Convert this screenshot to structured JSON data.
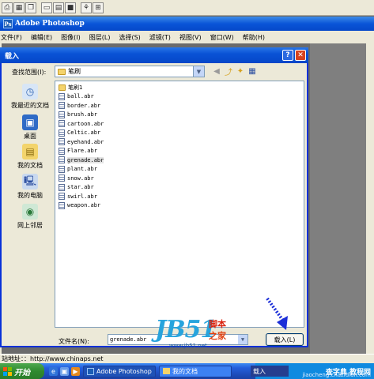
{
  "app": {
    "title": "Adobe Photoshop",
    "menu": [
      "文件(F)",
      "编辑(E)",
      "图像(I)",
      "图层(L)",
      "选择(S)",
      "滤镜(T)",
      "视图(V)",
      "窗口(W)",
      "帮助(H)"
    ]
  },
  "dialog": {
    "title": "载入",
    "help_glyph": "?",
    "close_glyph": "✕",
    "lookin_label": "查找范围(I):",
    "lookin_value": "笔刷",
    "places": [
      {
        "label": "我最近的文档",
        "icon": "recent-icon"
      },
      {
        "label": "桌面",
        "icon": "desktop-icon"
      },
      {
        "label": "我的文档",
        "icon": "my-documents-icon"
      },
      {
        "label": "我的电脑",
        "icon": "my-computer-icon"
      },
      {
        "label": "网上邻居",
        "icon": "network-icon"
      }
    ],
    "folder": "笔刷1",
    "files": [
      "ball.abr",
      "border.abr",
      "brush.abr",
      "cartoon.abr",
      "Celtic.abr",
      "eyehand.abr",
      "Flare.abr",
      "grenade.abr",
      "plant.abr",
      "snow.abr",
      "star.abr",
      "swirl.abr",
      "weapon.abr"
    ],
    "selected_file": "grenade.abr",
    "filename_label": "文件名(N):",
    "filename_value": "grenade.abr",
    "load_button": "载入(L)"
  },
  "watermark": {
    "logo": "JB51",
    "cn1": "脚本",
    "cn2": "之家",
    "url": "www.jb51.net"
  },
  "status": {
    "text": "站地址：：http://www.chinaps.net"
  },
  "taskbar": {
    "start": "开始",
    "tasks": [
      "Adobe Photoshop",
      "我的文档"
    ],
    "task_small": "载入",
    "tray_text": "查字典 教程网",
    "tray_url": "jiaocheng.chazidian.com"
  },
  "colors": {
    "title_blue": "#0a53d6",
    "close_red": "#d7421e",
    "watermark_blue": "#27a4dd",
    "watermark_red": "#d9220d"
  }
}
